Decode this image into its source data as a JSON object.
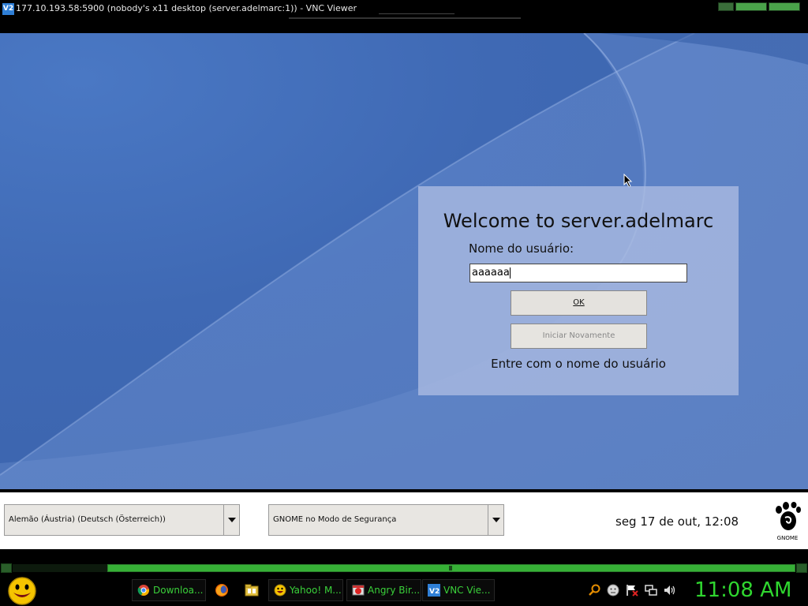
{
  "vnc_window": {
    "icon_text": "V2",
    "title": "177.10.193.58:5900 (nobody's x11 desktop (server.adelmarc:1)) - VNC Viewer"
  },
  "login": {
    "welcome": "Welcome to server.adelmarc",
    "username_label": "Nome do usuário:",
    "username_value": "aaaaaa",
    "ok_label": "OK",
    "restart_label": "Iniciar Novamente",
    "hint": "Entre com o nome do usuário"
  },
  "gdm_bar": {
    "language": "Alemão (Áustria) (Deutsch (Österreich))",
    "session": "GNOME no Modo de Segurança",
    "datetime": "seg 17 de out, 12:08",
    "logo_text": "GNOME"
  },
  "taskbar": {
    "tasks": [
      {
        "label": "Downloa...",
        "icon": "chrome-icon"
      },
      {
        "label": "Yahoo! M...",
        "icon": "yahoo-messenger-icon"
      },
      {
        "label": "Angry Bir...",
        "icon": "angry-birds-icon"
      },
      {
        "label": "VNC Vie...",
        "icon": "vnc-icon"
      }
    ],
    "clock": "11:08 AM"
  },
  "colors": {
    "taskbar_text": "#3ad13a",
    "desktop_blue": "#3f69b4",
    "dialog_bg": "#a8bae0"
  }
}
